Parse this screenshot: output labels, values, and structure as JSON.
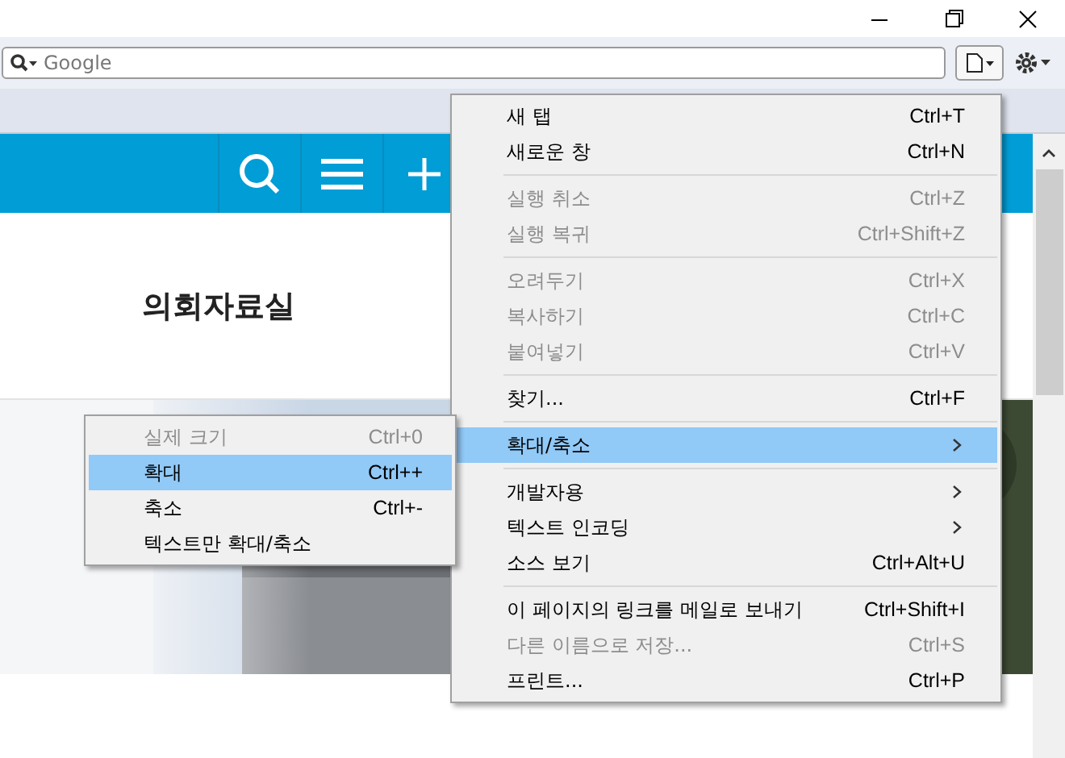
{
  "search": {
    "placeholder": "Google"
  },
  "site_nav": {
    "items": [
      {
        "label": "의회자료실"
      }
    ]
  },
  "menu": {
    "items": [
      {
        "kind": "item",
        "label": "새 탭",
        "shortcut": "Ctrl+T",
        "disabled": false,
        "selected": false
      },
      {
        "kind": "item",
        "label": "새로운 창",
        "shortcut": "Ctrl+N",
        "disabled": false,
        "selected": false
      },
      {
        "kind": "separator"
      },
      {
        "kind": "item",
        "label": "실행 취소",
        "shortcut": "Ctrl+Z",
        "disabled": true,
        "selected": false
      },
      {
        "kind": "item",
        "label": "실행 복귀",
        "shortcut": "Ctrl+Shift+Z",
        "disabled": true,
        "selected": false
      },
      {
        "kind": "separator"
      },
      {
        "kind": "item",
        "label": "오려두기",
        "shortcut": "Ctrl+X",
        "disabled": true,
        "selected": false
      },
      {
        "kind": "item",
        "label": "복사하기",
        "shortcut": "Ctrl+C",
        "disabled": true,
        "selected": false
      },
      {
        "kind": "item",
        "label": "붙여넣기",
        "shortcut": "Ctrl+V",
        "disabled": true,
        "selected": false
      },
      {
        "kind": "separator"
      },
      {
        "kind": "item",
        "label": "찾기...",
        "shortcut": "Ctrl+F",
        "disabled": false,
        "selected": false
      },
      {
        "kind": "separator"
      },
      {
        "kind": "submenu",
        "label": "확대/축소",
        "disabled": false,
        "selected": true
      },
      {
        "kind": "separator"
      },
      {
        "kind": "submenu",
        "label": "개발자용",
        "disabled": false,
        "selected": false
      },
      {
        "kind": "submenu",
        "label": "텍스트 인코딩",
        "disabled": false,
        "selected": false
      },
      {
        "kind": "item",
        "label": "소스 보기",
        "shortcut": "Ctrl+Alt+U",
        "disabled": false,
        "selected": false
      },
      {
        "kind": "separator"
      },
      {
        "kind": "item",
        "label": "이 페이지의 링크를 메일로 보내기",
        "shortcut": "Ctrl+Shift+I",
        "disabled": false,
        "selected": false
      },
      {
        "kind": "item",
        "label": "다른 이름으로 저장...",
        "shortcut": "Ctrl+S",
        "disabled": true,
        "selected": false
      },
      {
        "kind": "item",
        "label": "프린트...",
        "shortcut": "Ctrl+P",
        "disabled": false,
        "selected": false
      }
    ]
  },
  "submenu": {
    "items": [
      {
        "kind": "item",
        "label": "실제 크기",
        "shortcut": "Ctrl+0",
        "disabled": true,
        "selected": false
      },
      {
        "kind": "item",
        "label": "확대",
        "shortcut": "Ctrl++",
        "disabled": false,
        "selected": true
      },
      {
        "kind": "item",
        "label": "축소",
        "shortcut": "Ctrl+-",
        "disabled": false,
        "selected": false
      },
      {
        "kind": "item",
        "label": "텍스트만 확대/축소",
        "disabled": false,
        "selected": false
      }
    ]
  }
}
